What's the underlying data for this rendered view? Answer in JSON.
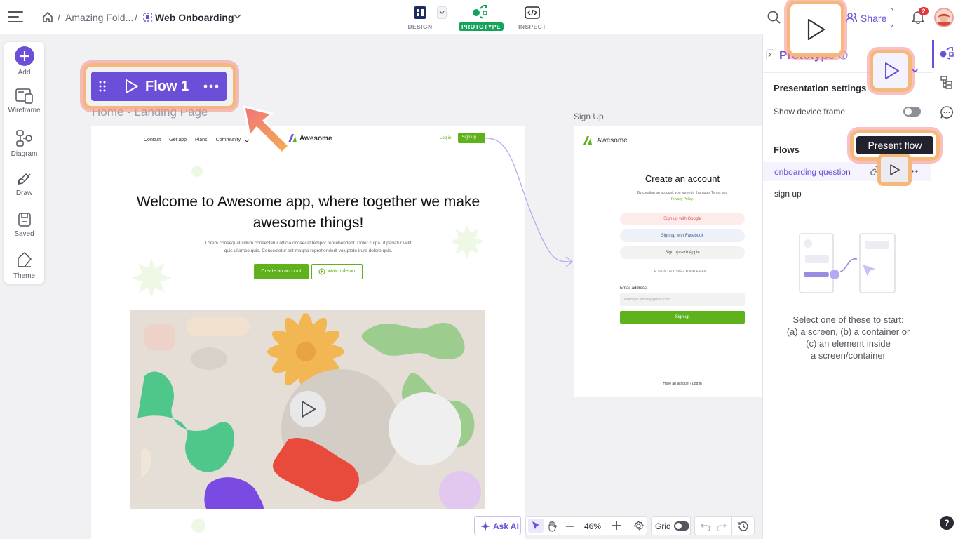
{
  "topbar": {
    "breadcrumb_folder": "Amazing Fold...",
    "breadcrumb_sep1": "/",
    "breadcrumb_sep2": "/",
    "project_name": "Web Onboarding",
    "modes": [
      "DESIGN",
      "PROTOTYPE",
      "INSPECT"
    ],
    "active_mode": "PROTOTYPE",
    "share_label": "Share",
    "notification_count": "2"
  },
  "left_toolbar": [
    "Add",
    "Wireframe",
    "Diagram",
    "Draw",
    "Saved",
    "Theme"
  ],
  "flow_chip": {
    "label": "Flow 1"
  },
  "canvas": {
    "home_title": "Home - Landing Page",
    "signup_title": "Sign Up",
    "home": {
      "nav_items": [
        "Contact",
        "Get app",
        "Plans",
        "Community"
      ],
      "logo": "Awesome",
      "login": "Log in",
      "signup_btn": "Sign up →",
      "headline_line1": "Welcome to Awesome app, where together we make",
      "headline_line2": "awesome things!",
      "body_line1": "Lorem consequat cillum consectetur officia occaecat tempor reprehenderit. Dolor culpa ut pariatur velit",
      "body_line2": "quis ullamco quis. Consectetur est magna reprehenderit voluptate irure dolore quis.",
      "cta_primary": "Create an account",
      "cta_secondary": "Watch demo"
    },
    "signup": {
      "logo": "Awesome",
      "heading": "Create an account",
      "terms_line1": "By creating an account, you agree to this app's Terms and",
      "terms_line2": "Privacy Policy.",
      "google": "Sign up with Google",
      "facebook": "Sign up with Facebook",
      "apple": "Sign up with Apple",
      "divider": "OR SIGN UP USING YOUR EMAIL",
      "email_label": "Email address",
      "email_placeholder": "example.email@gmail.com",
      "submit": "Sign up",
      "footer": "Have an account? Log in"
    }
  },
  "bottom_toolbar": {
    "ask_ai": "Ask AI",
    "zoom": "46%",
    "grid_label": "Grid",
    "grid_on": false
  },
  "prototype_panel": {
    "title": "Prototype",
    "presentation_settings": "Presentation settings",
    "show_device_frame": "Show device frame",
    "show_device_frame_on": false,
    "flows_heading": "Flows",
    "flows": [
      "onboarding question",
      "sign up"
    ],
    "tooltip": "Present flow",
    "empty_line1": "Select one of these to start:",
    "empty_line2": "(a) a screen, (b) a container or",
    "empty_line3": "(c) an element inside",
    "empty_line4": "a screen/container"
  },
  "colors": {
    "accent": "#6c4fd8",
    "brand_green": "#5fb21c",
    "highlight": "#f5b87a",
    "prototype_green": "#15a35a"
  },
  "icons": [
    "menu-icon",
    "home-icon",
    "component-icon",
    "chevron-down-icon",
    "search-icon",
    "play-icon",
    "people-icon",
    "bell-icon",
    "avatar",
    "plus-icon",
    "wireframe-icon",
    "diagram-icon",
    "draw-icon",
    "saved-icon",
    "theme-icon",
    "drag-handle-icon",
    "more-icon",
    "sparkle-icon",
    "cursor-icon",
    "hand-icon",
    "minus-icon",
    "settings-icon",
    "undo-icon",
    "redo-icon",
    "history-icon",
    "info-icon",
    "link-icon",
    "layers-icon",
    "comment-icon",
    "help-icon"
  ]
}
